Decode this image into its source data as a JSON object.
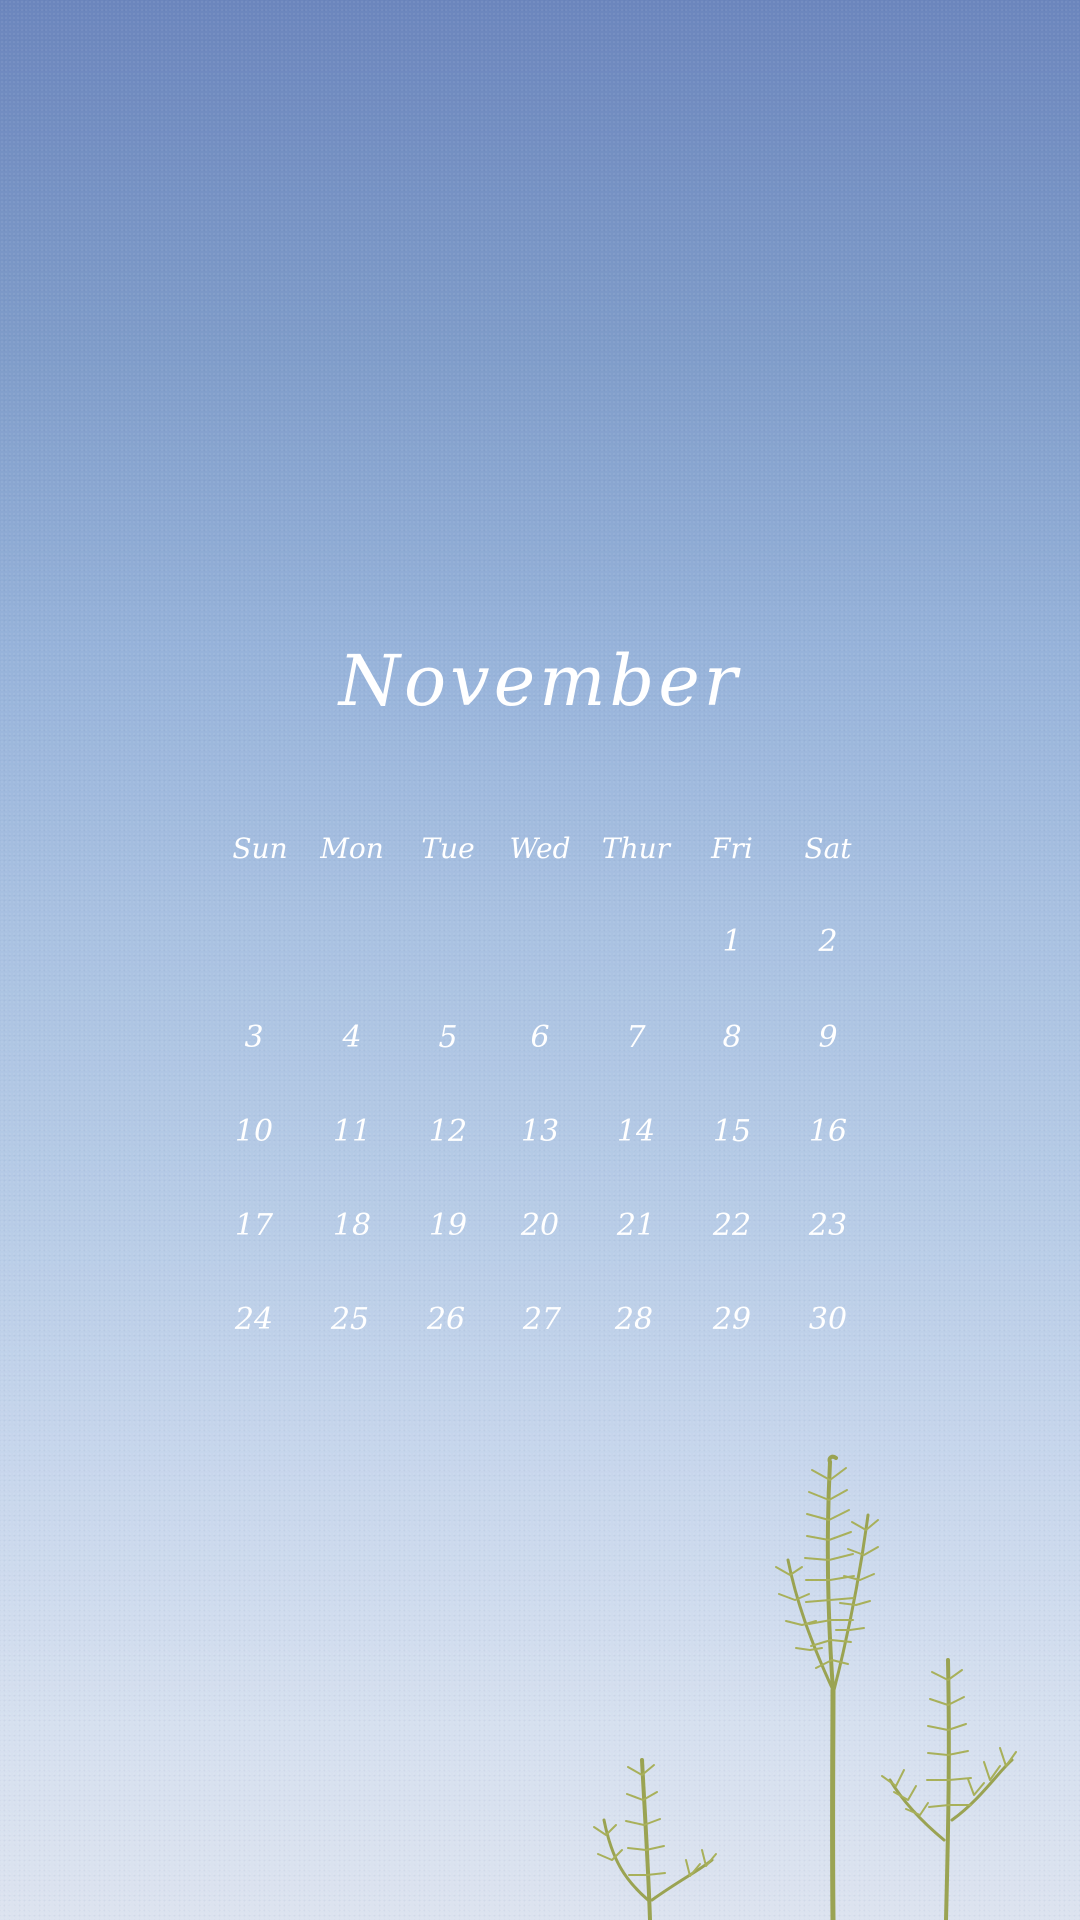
{
  "calendar": {
    "month": "November",
    "weekdays": [
      "Sun",
      "Mon",
      "Tue",
      "Wed",
      "Thur",
      "Fri",
      "Sat"
    ],
    "weeks": [
      [
        "",
        "",
        "",
        "",
        "",
        "1",
        "2"
      ],
      [
        "3",
        "4",
        "5",
        "6",
        "7",
        "8",
        "9"
      ],
      [
        "10",
        "11",
        "12",
        "13",
        "14",
        "15",
        "16"
      ],
      [
        "17",
        "18",
        "19",
        "20",
        "21",
        "22",
        "23"
      ],
      [
        "24",
        "25",
        "26",
        "27",
        "28",
        "29",
        "30"
      ]
    ]
  },
  "colors": {
    "sky_top": "#6c86bd",
    "sky_bottom": "#dce3ef",
    "text": "#ffffff",
    "grid_lines": "#d9e1ee",
    "plant": "#9aa352"
  }
}
